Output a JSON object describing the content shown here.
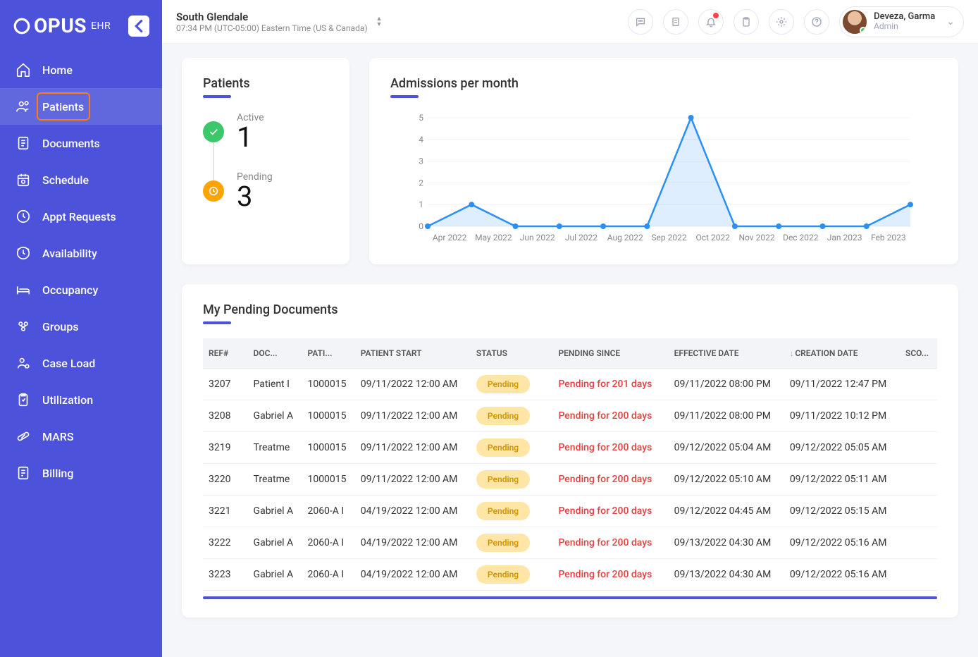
{
  "brand": {
    "name": "OPUS",
    "suffix": "EHR"
  },
  "sidebar": {
    "items": [
      {
        "label": "Home"
      },
      {
        "label": "Patients"
      },
      {
        "label": "Documents"
      },
      {
        "label": "Schedule"
      },
      {
        "label": "Appt Requests"
      },
      {
        "label": "Availability"
      },
      {
        "label": "Occupancy"
      },
      {
        "label": "Groups"
      },
      {
        "label": "Case Load"
      },
      {
        "label": "Utilization"
      },
      {
        "label": "MARS"
      },
      {
        "label": "Billing"
      }
    ]
  },
  "header": {
    "location_name": "South Glendale",
    "location_tz": "07:34 PM (UTC-05:00) Eastern Time (US & Canada)",
    "user_name": "Deveza, Garma",
    "user_role": "Admin"
  },
  "patients_card": {
    "title": "Patients",
    "active_label": "Active",
    "active_value": "1",
    "pending_label": "Pending",
    "pending_value": "3"
  },
  "chart_card": {
    "title": "Admissions per month"
  },
  "chart_data": {
    "type": "line",
    "categories": [
      "Apr 2022",
      "May 2022",
      "Jun 2022",
      "Jul 2022",
      "Aug 2022",
      "Sep 2022",
      "Oct 2022",
      "Nov 2022",
      "Dec 2022",
      "Jan 2023",
      "Feb 2023"
    ],
    "values": [
      0,
      1,
      0,
      0,
      0,
      0,
      5,
      0,
      0,
      0,
      0,
      1
    ],
    "title": "Admissions per month",
    "xlabel": "",
    "ylabel": "",
    "ylim": [
      0,
      5
    ],
    "y_ticks": [
      0,
      1,
      2,
      3,
      4,
      5
    ]
  },
  "docs": {
    "title": "My Pending Documents",
    "headers": {
      "ref": "REF#",
      "doc": "DOC...",
      "pat": "PATI...",
      "start": "PATIENT START",
      "status": "STATUS",
      "since": "PENDING SINCE",
      "eff": "EFFECTIVE DATE",
      "create": "CREATION DATE",
      "sco": "SCO..."
    },
    "status_label": "Pending",
    "rows": [
      {
        "ref": "3207",
        "doc": "Patient I",
        "pat": "1000015",
        "start": "09/11/2022 12:00 AM",
        "since": "Pending for 201 days",
        "eff": "09/11/2022 08:00 PM",
        "create": "09/11/2022 12:47 PM"
      },
      {
        "ref": "3208",
        "doc": "Gabriel A",
        "pat": "1000015",
        "start": "09/11/2022 12:00 AM",
        "since": "Pending for 200 days",
        "eff": "09/11/2022 08:00 PM",
        "create": "09/11/2022 10:12 PM"
      },
      {
        "ref": "3219",
        "doc": "Treatme",
        "pat": "1000015",
        "start": "09/11/2022 12:00 AM",
        "since": "Pending for 200 days",
        "eff": "09/12/2022 05:04 AM",
        "create": "09/12/2022 05:05 AM"
      },
      {
        "ref": "3220",
        "doc": "Treatme",
        "pat": "1000015",
        "start": "09/11/2022 12:00 AM",
        "since": "Pending for 200 days",
        "eff": "09/12/2022 05:10 AM",
        "create": "09/12/2022 05:11 AM"
      },
      {
        "ref": "3221",
        "doc": "Gabriel A",
        "pat": "2060-A I",
        "start": "04/19/2022 12:00 AM",
        "since": "Pending for 200 days",
        "eff": "09/12/2022 04:45 AM",
        "create": "09/12/2022 05:15 AM"
      },
      {
        "ref": "3222",
        "doc": "Gabriel A",
        "pat": "2060-A I",
        "start": "04/19/2022 12:00 AM",
        "since": "Pending for 200 days",
        "eff": "09/13/2022 04:30 AM",
        "create": "09/12/2022 05:16 AM"
      },
      {
        "ref": "3223",
        "doc": "Gabriel A",
        "pat": "2060-A I",
        "start": "04/19/2022 12:00 AM",
        "since": "Pending for 200 days",
        "eff": "09/13/2022 04:30 AM",
        "create": "09/12/2022 05:16 AM"
      }
    ]
  }
}
